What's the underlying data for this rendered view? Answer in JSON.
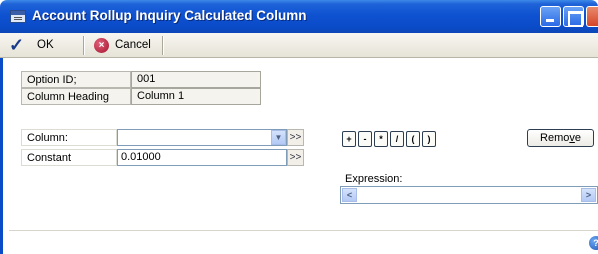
{
  "window": {
    "title": "Account Rollup Inquiry Calculated Column"
  },
  "toolbar": {
    "ok_label": "OK",
    "cancel_label": "Cancel"
  },
  "fields": {
    "option_id_label": "Option ID;",
    "option_id_value": "001",
    "column_heading_label": "Column Heading",
    "column_heading_value": "Column 1",
    "column_label": "Column:",
    "column_value": "",
    "constant_label": "Constant",
    "constant_value": "0.01000"
  },
  "operators": [
    "+",
    "-",
    "*",
    "/",
    "(",
    ")"
  ],
  "remove_button": {
    "prefix": "Remo",
    "mnemonic": "v",
    "suffix": "e"
  },
  "expression": {
    "label": "Expression:",
    "value": ""
  },
  "icons": {
    "check": "check-icon",
    "cancel": "cancel-icon",
    "help": "help-icon",
    "window": "window-icon"
  }
}
